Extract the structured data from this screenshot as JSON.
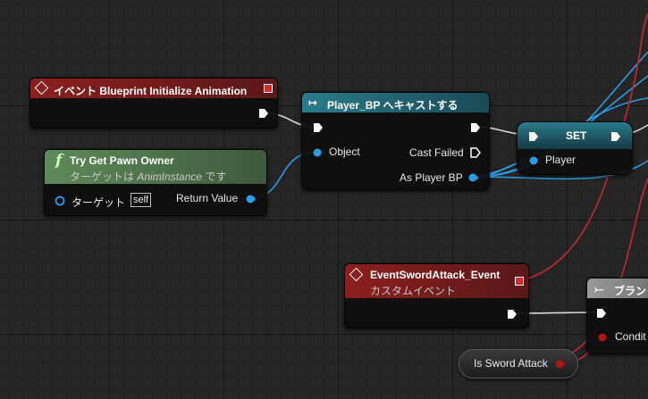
{
  "colors": {
    "event_header": "#7a1d1d",
    "cast_header": "#1f6676",
    "func_header": "#5a7a56",
    "set_header": "#1f6676",
    "branch_header": "#8a8a8a",
    "obj_pin": "#2b9de6",
    "bool_pin": "#b11616"
  },
  "icons": [
    "diamond-event-icon",
    "cast-arrow-icon",
    "function-f-icon",
    "branch-icon",
    "exec-pin-icon",
    "object-pin-icon",
    "bool-pin-icon"
  ],
  "nodes": {
    "init_anim": {
      "title": "イベント Blueprint Initialize Animation"
    },
    "pawn_owner": {
      "icon": "f",
      "title": "Try Get Pawn Owner",
      "sub_prefix": "ターゲットは ",
      "sub_target": "AnimInstance",
      "sub_suffix": " です",
      "target_label": "ターゲット",
      "self_label": "self",
      "return_label": "Return Value"
    },
    "cast": {
      "title": "Player_BP へキャストする",
      "object_label": "Object",
      "failed_label": "Cast Failed",
      "as_label": "As Player BP"
    },
    "set": {
      "title": "SET",
      "player_label": "Player"
    },
    "sword_event": {
      "title": "EventSwordAttack_Event",
      "subtitle": "カスタムイベント"
    },
    "branch": {
      "title": "ブラン",
      "condition_label": "Condit"
    },
    "is_sword": {
      "label": "Is Sword Attack"
    }
  }
}
